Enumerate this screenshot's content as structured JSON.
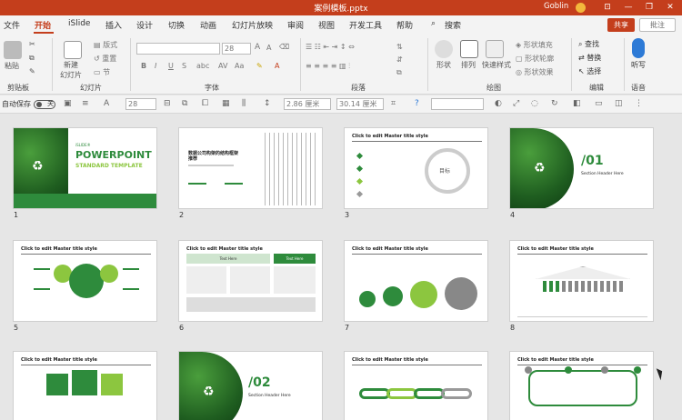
{
  "titlebar": {
    "title": "案例模板.pptx",
    "user": "Goblin",
    "min": "—",
    "restore": "❐",
    "close": "✕",
    "ribbon_btn": "⊡"
  },
  "menu": {
    "tabs": [
      "文件",
      "开始",
      "iSlide",
      "插入",
      "设计",
      "切换",
      "动画",
      "幻灯片放映",
      "审阅",
      "视图",
      "开发工具",
      "帮助",
      "搜索"
    ],
    "active": "开始",
    "share": "共享",
    "comment": "批注"
  },
  "ribbon": {
    "groups": {
      "clipboard": "剪贴板",
      "slides": "幻灯片",
      "font": "字体",
      "paragraph": "段落",
      "drawing": "绘图",
      "editing": "编辑",
      "voice": "语音"
    },
    "paste": "粘贴",
    "new_slide": "新建",
    "new_slide2": "幻灯片",
    "layout": "版式",
    "reset": "重置",
    "section": "节",
    "font_size": "28",
    "shape": "形状",
    "arrange": "排列",
    "quick_styles": "快速样式",
    "shape_fill": "形状填充",
    "shape_outline": "形状轮廓",
    "shape_effects": "形状效果",
    "find": "查找",
    "replace": "替换",
    "select": "选择",
    "dictate": "听写",
    "bold": "B",
    "italic": "I",
    "underline": "U",
    "strike": "S",
    "grow": "A",
    "shrink": "A"
  },
  "qat": {
    "autosave": "自动保存",
    "toggle_state": "关",
    "font_size": "28",
    "width": "2.86 厘米",
    "height": "30.14 厘米"
  },
  "slides": [
    {
      "num": "1",
      "title": "POWERPOINT",
      "subtitle": "STANDARD TEMPLATE",
      "brand": "iSLIDE®"
    },
    {
      "num": "2",
      "heading": "数据公司构架的结构框架推荐"
    },
    {
      "num": "3",
      "title": "Click to edit Master title style",
      "center": "目标"
    },
    {
      "num": "4",
      "big": "/01",
      "caption": "Section Header Here"
    },
    {
      "num": "5",
      "title": "Click to edit Master title style"
    },
    {
      "num": "6",
      "title": "Click to edit Master title style",
      "col1": "Text Here",
      "col2": "Text Here"
    },
    {
      "num": "7",
      "title": "Click to edit Master title style"
    },
    {
      "num": "8",
      "title": "Click to edit Master title style"
    },
    {
      "num": "9",
      "title": "Click to edit Master title style"
    },
    {
      "num": "10",
      "big": "/02",
      "caption": "Section Header Here"
    },
    {
      "num": "11",
      "title": "Click to edit Master title style"
    },
    {
      "num": "12",
      "title": "Click to edit Master title style"
    }
  ],
  "colors": {
    "accent": "#c43e1c",
    "green": "#2e8b3c",
    "lightgreen": "#8cc63f"
  }
}
